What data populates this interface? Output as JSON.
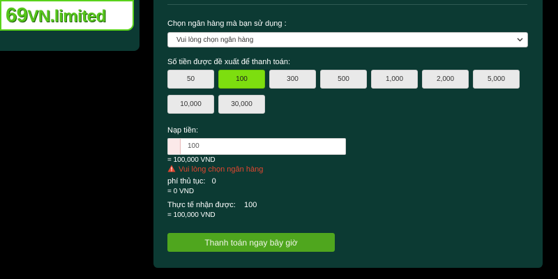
{
  "brand": {
    "logo_main": "69",
    "logo_rest": "VN.limited"
  },
  "bank": {
    "label": "Chọn ngân hàng mà bạn sử dụng :",
    "selected": "Vui lòng chọn ngân hàng"
  },
  "suggested": {
    "label": "Số tiền được đề xuất để thanh toán:",
    "amounts": [
      "50",
      "100",
      "300",
      "500",
      "1,000",
      "2,000",
      "5,000",
      "10,000",
      "30,000"
    ],
    "active_index": 1
  },
  "deposit": {
    "label": "Nạp tiền:",
    "value": "100",
    "converted": "= 100,000 VND"
  },
  "error": {
    "message": "Vui lòng chọn ngân hàng"
  },
  "fee": {
    "label": "phí thủ tục:",
    "value": "0",
    "converted": "= 0 VND"
  },
  "received": {
    "label": "Thực tế nhận được:",
    "value": "100",
    "converted": "= 100,000 VND"
  },
  "actions": {
    "pay_label": "Thanh toán ngay bây giờ"
  },
  "colors": {
    "panel": "#0c3a33",
    "active_amount": "#7dde0f",
    "pay_button": "#4fa61e",
    "error": "#e1462f",
    "brand_green": "#56c51b"
  }
}
